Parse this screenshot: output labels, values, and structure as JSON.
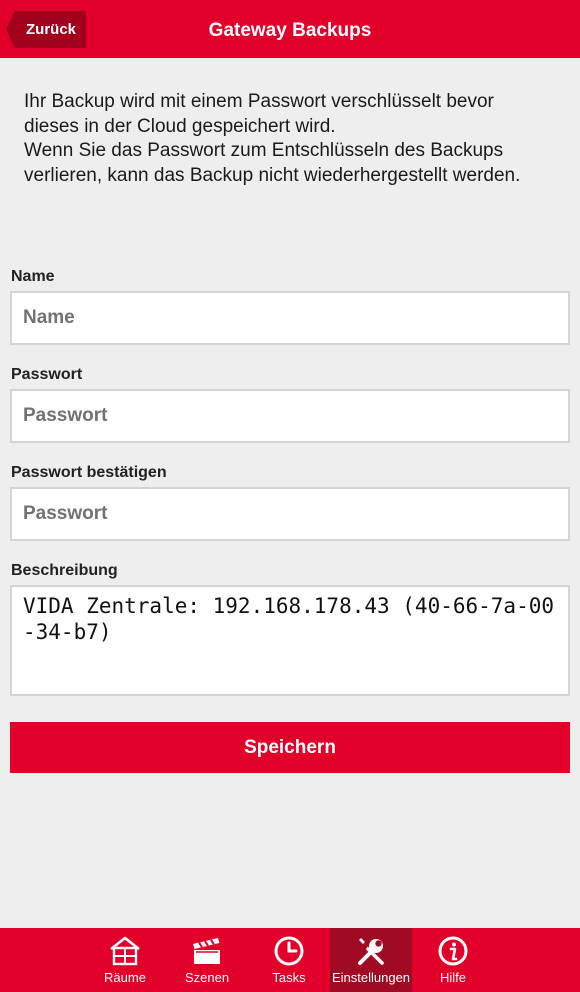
{
  "header": {
    "back_label": "Zurück",
    "title": "Gateway Backups"
  },
  "intro": {
    "line1": "Ihr Backup wird mit einem Passwort verschlüsselt bevor dieses in der Cloud gespeichert wird.",
    "line2": "Wenn Sie das Passwort zum Entschlüsseln des Backups verlieren, kann das Backup nicht wiederhergestellt werden."
  },
  "form": {
    "name": {
      "label": "Name",
      "placeholder": "Name",
      "value": ""
    },
    "password": {
      "label": "Passwort",
      "placeholder": "Passwort",
      "value": ""
    },
    "password_confirm": {
      "label": "Passwort bestätigen",
      "placeholder": "Passwort",
      "value": ""
    },
    "description": {
      "label": "Beschreibung",
      "value": "VIDA Zentrale: 192.168.178.43 (40-66-7a-00-34-b7)"
    },
    "save_label": "Speichern"
  },
  "tabbar": {
    "items": [
      {
        "label": "Räume",
        "icon": "house-icon"
      },
      {
        "label": "Szenen",
        "icon": "clapperboard-icon"
      },
      {
        "label": "Tasks",
        "icon": "clock-icon"
      },
      {
        "label": "Einstellungen",
        "icon": "wrench-screwdriver-icon",
        "active": true
      },
      {
        "label": "Hilfe",
        "icon": "info-icon"
      }
    ]
  },
  "colors": {
    "brand_red": "#e2002a",
    "active_tab": "#a00a23",
    "back_button": "#a3001e",
    "background": "#eeeeee"
  }
}
